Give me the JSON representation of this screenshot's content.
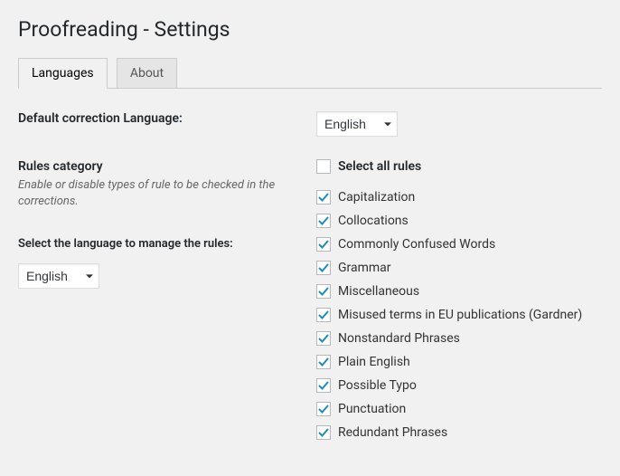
{
  "title": "Proofreading - Settings",
  "tabs": {
    "languages": "Languages",
    "about": "About"
  },
  "defaultLang": {
    "label": "Default correction Language:",
    "value": "English"
  },
  "rulesCategory": {
    "heading": "Rules category",
    "desc": "Enable or disable types of rule to be checked in the corrections.",
    "selectLangLabel": "Select the language to manage the rules:",
    "selectLangValue": "English"
  },
  "selectAll": {
    "label": "Select all rules",
    "checked": false
  },
  "rules": [
    {
      "label": "Capitalization",
      "checked": true
    },
    {
      "label": "Collocations",
      "checked": true
    },
    {
      "label": "Commonly Confused Words",
      "checked": true
    },
    {
      "label": "Grammar",
      "checked": true
    },
    {
      "label": "Miscellaneous",
      "checked": true
    },
    {
      "label": "Misused terms in EU publications (Gardner)",
      "checked": true
    },
    {
      "label": "Nonstandard Phrases",
      "checked": true
    },
    {
      "label": "Plain English",
      "checked": true
    },
    {
      "label": "Possible Typo",
      "checked": true
    },
    {
      "label": "Punctuation",
      "checked": true
    },
    {
      "label": "Redundant Phrases",
      "checked": true
    }
  ]
}
